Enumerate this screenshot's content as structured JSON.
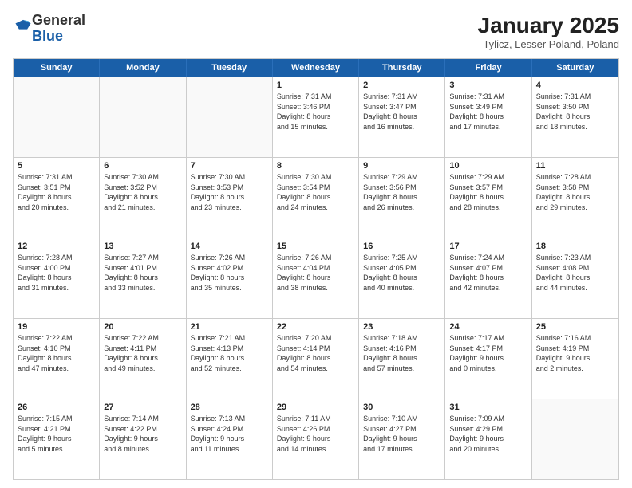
{
  "logo": {
    "general": "General",
    "blue": "Blue"
  },
  "header": {
    "month": "January 2025",
    "location": "Tylicz, Lesser Poland, Poland"
  },
  "weekdays": [
    "Sunday",
    "Monday",
    "Tuesday",
    "Wednesday",
    "Thursday",
    "Friday",
    "Saturday"
  ],
  "rows": [
    [
      {
        "day": "",
        "empty": true
      },
      {
        "day": "",
        "empty": true
      },
      {
        "day": "",
        "empty": true
      },
      {
        "day": "1",
        "line1": "Sunrise: 7:31 AM",
        "line2": "Sunset: 3:46 PM",
        "line3": "Daylight: 8 hours",
        "line4": "and 15 minutes."
      },
      {
        "day": "2",
        "line1": "Sunrise: 7:31 AM",
        "line2": "Sunset: 3:47 PM",
        "line3": "Daylight: 8 hours",
        "line4": "and 16 minutes."
      },
      {
        "day": "3",
        "line1": "Sunrise: 7:31 AM",
        "line2": "Sunset: 3:49 PM",
        "line3": "Daylight: 8 hours",
        "line4": "and 17 minutes."
      },
      {
        "day": "4",
        "line1": "Sunrise: 7:31 AM",
        "line2": "Sunset: 3:50 PM",
        "line3": "Daylight: 8 hours",
        "line4": "and 18 minutes."
      }
    ],
    [
      {
        "day": "5",
        "line1": "Sunrise: 7:31 AM",
        "line2": "Sunset: 3:51 PM",
        "line3": "Daylight: 8 hours",
        "line4": "and 20 minutes."
      },
      {
        "day": "6",
        "line1": "Sunrise: 7:30 AM",
        "line2": "Sunset: 3:52 PM",
        "line3": "Daylight: 8 hours",
        "line4": "and 21 minutes."
      },
      {
        "day": "7",
        "line1": "Sunrise: 7:30 AM",
        "line2": "Sunset: 3:53 PM",
        "line3": "Daylight: 8 hours",
        "line4": "and 23 minutes."
      },
      {
        "day": "8",
        "line1": "Sunrise: 7:30 AM",
        "line2": "Sunset: 3:54 PM",
        "line3": "Daylight: 8 hours",
        "line4": "and 24 minutes."
      },
      {
        "day": "9",
        "line1": "Sunrise: 7:29 AM",
        "line2": "Sunset: 3:56 PM",
        "line3": "Daylight: 8 hours",
        "line4": "and 26 minutes."
      },
      {
        "day": "10",
        "line1": "Sunrise: 7:29 AM",
        "line2": "Sunset: 3:57 PM",
        "line3": "Daylight: 8 hours",
        "line4": "and 28 minutes."
      },
      {
        "day": "11",
        "line1": "Sunrise: 7:28 AM",
        "line2": "Sunset: 3:58 PM",
        "line3": "Daylight: 8 hours",
        "line4": "and 29 minutes."
      }
    ],
    [
      {
        "day": "12",
        "line1": "Sunrise: 7:28 AM",
        "line2": "Sunset: 4:00 PM",
        "line3": "Daylight: 8 hours",
        "line4": "and 31 minutes."
      },
      {
        "day": "13",
        "line1": "Sunrise: 7:27 AM",
        "line2": "Sunset: 4:01 PM",
        "line3": "Daylight: 8 hours",
        "line4": "and 33 minutes."
      },
      {
        "day": "14",
        "line1": "Sunrise: 7:26 AM",
        "line2": "Sunset: 4:02 PM",
        "line3": "Daylight: 8 hours",
        "line4": "and 35 minutes."
      },
      {
        "day": "15",
        "line1": "Sunrise: 7:26 AM",
        "line2": "Sunset: 4:04 PM",
        "line3": "Daylight: 8 hours",
        "line4": "and 38 minutes."
      },
      {
        "day": "16",
        "line1": "Sunrise: 7:25 AM",
        "line2": "Sunset: 4:05 PM",
        "line3": "Daylight: 8 hours",
        "line4": "and 40 minutes."
      },
      {
        "day": "17",
        "line1": "Sunrise: 7:24 AM",
        "line2": "Sunset: 4:07 PM",
        "line3": "Daylight: 8 hours",
        "line4": "and 42 minutes."
      },
      {
        "day": "18",
        "line1": "Sunrise: 7:23 AM",
        "line2": "Sunset: 4:08 PM",
        "line3": "Daylight: 8 hours",
        "line4": "and 44 minutes."
      }
    ],
    [
      {
        "day": "19",
        "line1": "Sunrise: 7:22 AM",
        "line2": "Sunset: 4:10 PM",
        "line3": "Daylight: 8 hours",
        "line4": "and 47 minutes."
      },
      {
        "day": "20",
        "line1": "Sunrise: 7:22 AM",
        "line2": "Sunset: 4:11 PM",
        "line3": "Daylight: 8 hours",
        "line4": "and 49 minutes."
      },
      {
        "day": "21",
        "line1": "Sunrise: 7:21 AM",
        "line2": "Sunset: 4:13 PM",
        "line3": "Daylight: 8 hours",
        "line4": "and 52 minutes."
      },
      {
        "day": "22",
        "line1": "Sunrise: 7:20 AM",
        "line2": "Sunset: 4:14 PM",
        "line3": "Daylight: 8 hours",
        "line4": "and 54 minutes."
      },
      {
        "day": "23",
        "line1": "Sunrise: 7:18 AM",
        "line2": "Sunset: 4:16 PM",
        "line3": "Daylight: 8 hours",
        "line4": "and 57 minutes."
      },
      {
        "day": "24",
        "line1": "Sunrise: 7:17 AM",
        "line2": "Sunset: 4:17 PM",
        "line3": "Daylight: 9 hours",
        "line4": "and 0 minutes."
      },
      {
        "day": "25",
        "line1": "Sunrise: 7:16 AM",
        "line2": "Sunset: 4:19 PM",
        "line3": "Daylight: 9 hours",
        "line4": "and 2 minutes."
      }
    ],
    [
      {
        "day": "26",
        "line1": "Sunrise: 7:15 AM",
        "line2": "Sunset: 4:21 PM",
        "line3": "Daylight: 9 hours",
        "line4": "and 5 minutes."
      },
      {
        "day": "27",
        "line1": "Sunrise: 7:14 AM",
        "line2": "Sunset: 4:22 PM",
        "line3": "Daylight: 9 hours",
        "line4": "and 8 minutes."
      },
      {
        "day": "28",
        "line1": "Sunrise: 7:13 AM",
        "line2": "Sunset: 4:24 PM",
        "line3": "Daylight: 9 hours",
        "line4": "and 11 minutes."
      },
      {
        "day": "29",
        "line1": "Sunrise: 7:11 AM",
        "line2": "Sunset: 4:26 PM",
        "line3": "Daylight: 9 hours",
        "line4": "and 14 minutes."
      },
      {
        "day": "30",
        "line1": "Sunrise: 7:10 AM",
        "line2": "Sunset: 4:27 PM",
        "line3": "Daylight: 9 hours",
        "line4": "and 17 minutes."
      },
      {
        "day": "31",
        "line1": "Sunrise: 7:09 AM",
        "line2": "Sunset: 4:29 PM",
        "line3": "Daylight: 9 hours",
        "line4": "and 20 minutes."
      },
      {
        "day": "",
        "empty": true
      }
    ]
  ]
}
